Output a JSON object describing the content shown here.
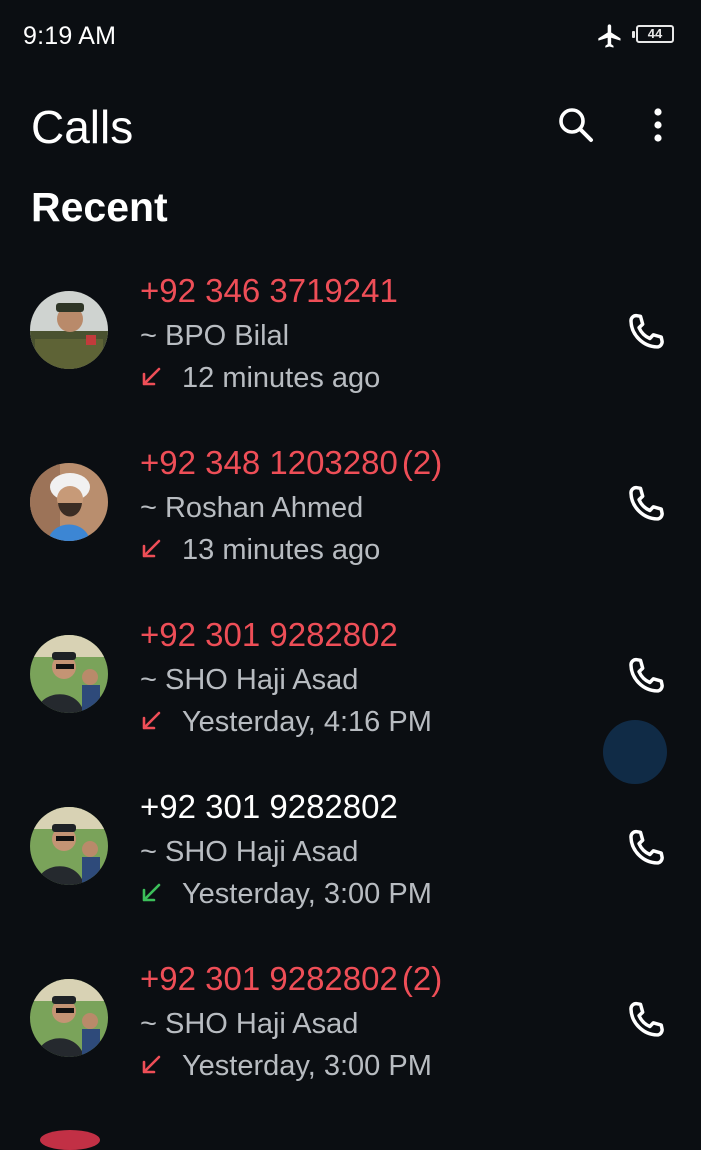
{
  "status_bar": {
    "time": "9:19 AM",
    "battery": "44",
    "icons": [
      "airplane-mode-icon",
      "battery-icon"
    ]
  },
  "header": {
    "title": "Calls",
    "actions": [
      "search-icon",
      "more-options-icon"
    ]
  },
  "section": {
    "title": "Recent"
  },
  "colors": {
    "background": "#0b0e12",
    "missed": "#ee4e57",
    "incoming": "#3cbf5a",
    "secondary_text": "#b8bcc1"
  },
  "calls": [
    {
      "number": "+92 346 3719241",
      "count": "",
      "name": "~ BPO Bilal",
      "time": "12 minutes ago",
      "type": "missed"
    },
    {
      "number": "+92 348 1203280",
      "count": "(2)",
      "name": "~ Roshan Ahmed",
      "time": "13 minutes ago",
      "type": "missed"
    },
    {
      "number": "+92 301 9282802",
      "count": "",
      "name": "~ SHO Haji Asad",
      "time": "Yesterday, 4:16 PM",
      "type": "missed"
    },
    {
      "number": "+92 301 9282802",
      "count": "",
      "name": "~ SHO Haji Asad",
      "time": "Yesterday, 3:00 PM",
      "type": "incoming"
    },
    {
      "number": "+92 301 9282802",
      "count": "(2)",
      "name": "~ SHO Haji Asad",
      "time": "Yesterday, 3:00 PM",
      "type": "missed"
    }
  ]
}
